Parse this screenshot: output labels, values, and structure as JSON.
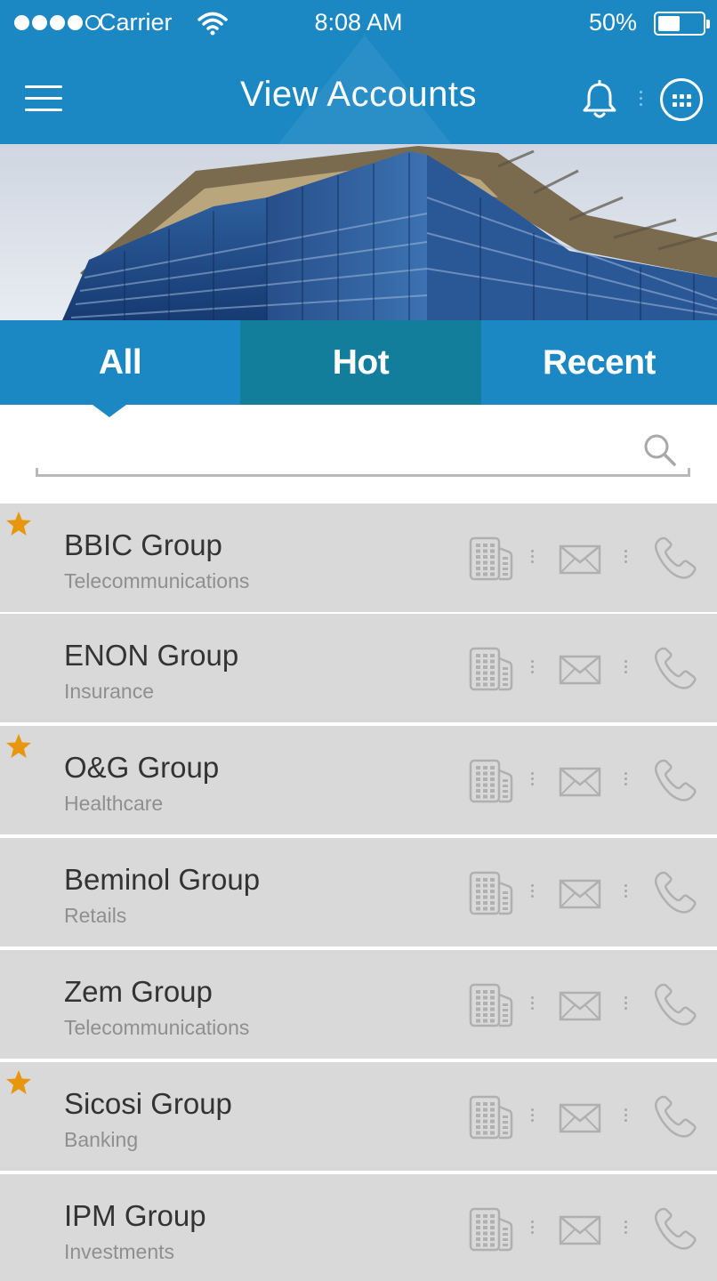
{
  "status_bar": {
    "carrier": "Carrier",
    "time": "8:08 AM",
    "battery_percent": "50%",
    "battery_level": 0.5,
    "signal_bars_filled": 4,
    "signal_bars_total": 5
  },
  "header": {
    "title": "View Accounts",
    "icons": [
      "menu-icon",
      "bell-icon",
      "apps-grid-icon"
    ]
  },
  "tabs": [
    {
      "label": "All",
      "selected": true
    },
    {
      "label": "Hot",
      "selected": false
    },
    {
      "label": "Recent",
      "selected": false
    }
  ],
  "search": {
    "value": "",
    "placeholder": "",
    "icon": "search-icon"
  },
  "accounts": [
    {
      "name": "BBIC Group",
      "category": "Telecommunications",
      "starred": true
    },
    {
      "name": "ENON Group",
      "category": "Insurance",
      "starred": false
    },
    {
      "name": "O&G Group",
      "category": "Healthcare",
      "starred": true
    },
    {
      "name": "Beminol Group",
      "category": "Retails",
      "starred": false
    },
    {
      "name": "Zem Group",
      "category": "Telecommunications",
      "starred": false
    },
    {
      "name": "Sicosi Group",
      "category": "Banking",
      "starred": true
    },
    {
      "name": "IPM Group",
      "category": "Investments",
      "starred": false
    }
  ],
  "row_action_icons": [
    "building-icon",
    "mail-icon",
    "phone-icon"
  ],
  "colors": {
    "primary": "#1b87c3",
    "hot_tab": "#137d9c",
    "row_background": "#d9d9d9",
    "star": "#e8960c",
    "action_icon": "#b0b0b0"
  }
}
